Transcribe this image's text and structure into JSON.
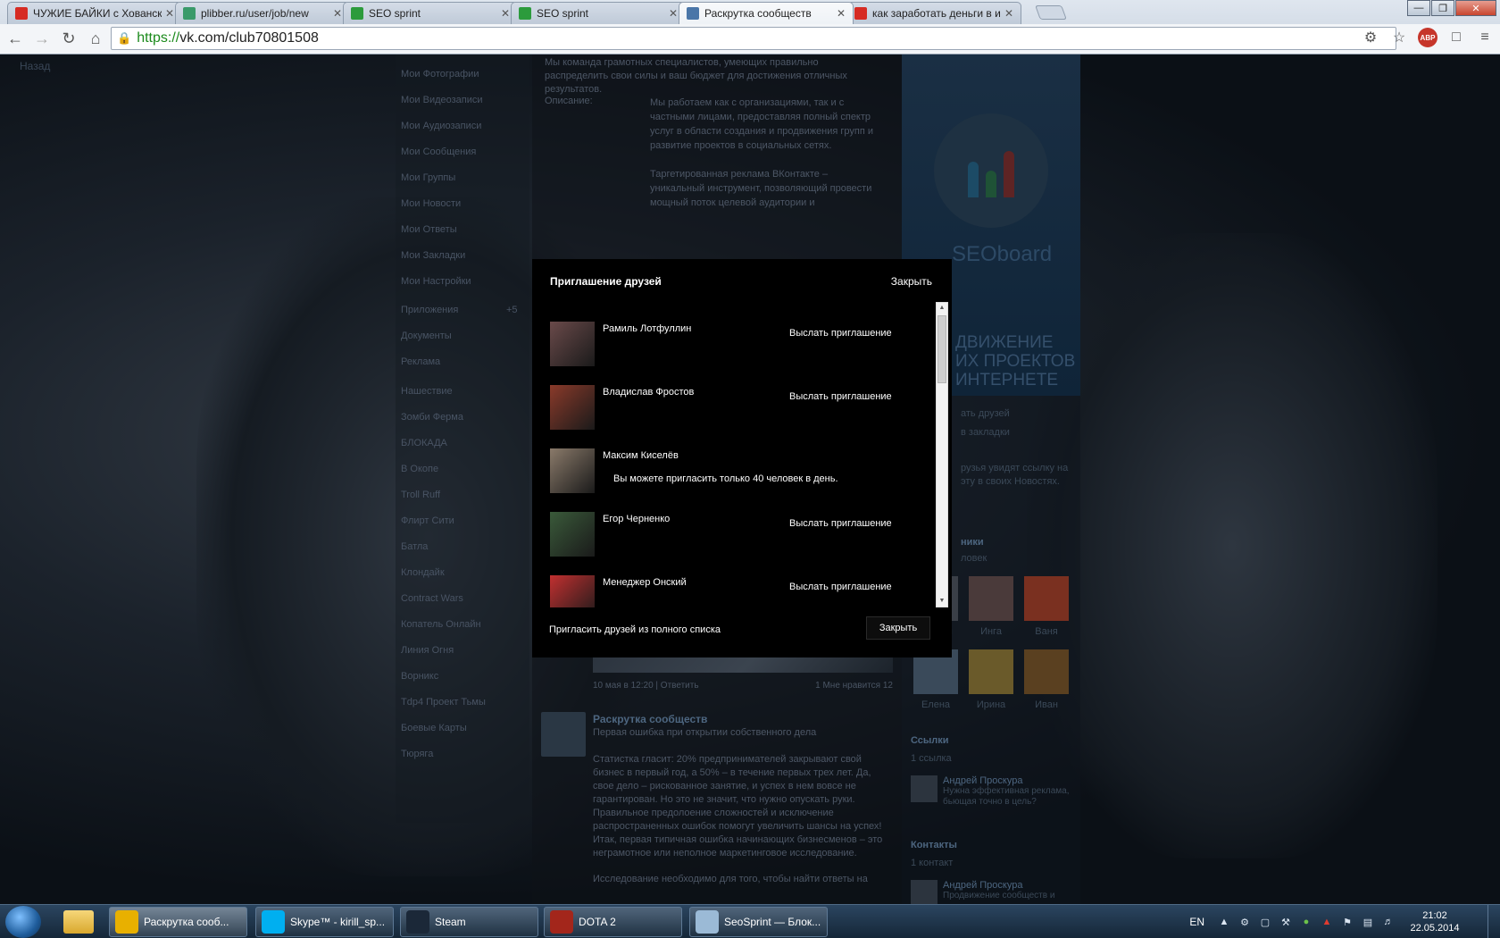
{
  "browser": {
    "tabs": [
      {
        "label": "ЧУЖИЕ БАЙКИ с Хованским",
        "icon": "youtube-icon",
        "color": "#d62b23"
      },
      {
        "label": "plibber.ru/user/job/new",
        "icon": "loading-icon",
        "color": "#3a9a6a"
      },
      {
        "label": "SEO sprint",
        "icon": "seosprint-icon",
        "color": "#2c9b3c"
      },
      {
        "label": "SEO sprint",
        "icon": "seosprint-icon",
        "color": "#2c9b3c"
      },
      {
        "label": "Раскрутка сообществ",
        "icon": "vk-icon",
        "color": "#4a76a8"
      },
      {
        "label": "как заработать деньги в ин",
        "icon": "youtube-icon",
        "color": "#d62b23"
      }
    ],
    "url_scheme": "https://",
    "url_host": "vk.com/club70801508"
  },
  "page": {
    "back_label": "Назад",
    "left_menu": [
      "Мои Фотографии",
      "Мои Видеозаписи",
      "Мои Аудиозаписи",
      "Мои Сообщения",
      "Мои Группы",
      "Мои Новости",
      "Мои Ответы",
      "Мои Закладки",
      "Мои Настройки",
      "Приложения",
      "Документы",
      "Реклама",
      "Нашествие",
      "Зомби Ферма",
      "БЛОКАДА",
      "В Окопе",
      "Troll Ruff",
      "Флирт Сити",
      "Батла",
      "Клондайк",
      "Contract Wars",
      "Копатель Онлайн",
      "Линия Огня",
      "Ворникс",
      "Tdp4 Проект Тьмы",
      "Боевые Карты",
      "Тюряга"
    ],
    "apps_badge": "+5",
    "intro": "Мы команда грамотных специалистов, умеющих правильно распределить свои силы и ваш бюджет для достижения отличных результатов.",
    "desc_label": "Описание:",
    "desc": "Мы работаем как с организациями, так и с частными лицами, предоставляя полный спектр услуг в области создания и продвижения групп и развитие проектов в социальных сетях.",
    "desc2": "Таргетированная реклама ВКонтакте – уникальный инструмент, позволяющий провести мощный поток целевой аудитории и",
    "post_meta_left": "10 мая в 12:20 | Ответить",
    "post_meta_right": "1    Мне нравится    12",
    "post2_title": "Раскрутка сообществ",
    "post2_sub": "Первая ошибка при открытии собственного дела",
    "post2_body": "Статистка гласит: 20% предпринимателей закрывают свой бизнес в первый год, а 50% – в течение первых трех лет. Да, свое дело – рискованное занятие, и успех в нем вовсе не гарантирован. Но это не значит, что нужно опускать руки. Правильное предолоение сложностей и исключение распространенных ошибок помогут увеличить шансы на успех! Итак, первая типичная ошибка начинающих бизнесменов – это неграмотное или неполное маркетинговое исследование.",
    "post2_body_2": "Исследование необходимо для того, чтобы найти ответы на",
    "logo_text": "SEOboard",
    "banner_text": "движение их проектов интернете",
    "rc_links": [
      "ать друзей",
      "в закладки"
    ],
    "rc_note": "рузья увидят ссылку на эту в своих Новостях.",
    "rc_members_head": "ники",
    "rc_members_count": "ловек",
    "friends": [
      "Кирилл",
      "Инга",
      "Ваня",
      "Елена",
      "Ирина",
      "Иван"
    ],
    "links_head": "Ссылки",
    "links_count": "1 ссылка",
    "link_person_name": "Андрей Проскура",
    "link_person_desc": "Нужна эффективная реклама, бьющая точно в цель?",
    "contacts_head": "Контакты",
    "contacts_count": "1 контакт",
    "contact_person_name": "Андрей Проскура",
    "contact_person_desc": "Продвижение сообществ и"
  },
  "modal": {
    "title": "Приглашение друзей",
    "close_top": "Закрыть",
    "invite_label": "Выслать приглашение",
    "limit_message": "Вы можете пригласить только 40 человек в день.",
    "friends": [
      {
        "name": "Рамиль Лотфуллин",
        "invite": true,
        "avatar_color": "#6a4a4a"
      },
      {
        "name": "Владислав Фростов",
        "invite": true,
        "avatar_color": "#8a3a2a"
      },
      {
        "name": "Максим Киселёв",
        "invite": false,
        "avatar_color": "#8a7a6a"
      },
      {
        "name": "Егор Черненко",
        "invite": true,
        "avatar_color": "#3a5a3a"
      },
      {
        "name": "Менеджер Онский",
        "invite": true,
        "avatar_color": "#c23030"
      }
    ],
    "footer_link": "Пригласить друзей из полного списка",
    "close_button": "Закрыть"
  },
  "taskbar": {
    "items": [
      {
        "label": "Раскрутка сооб...",
        "icon": "chrome-icon",
        "color": "#e8b000",
        "active": true
      },
      {
        "label": "Skype™ - kirill_sp...",
        "icon": "skype-icon",
        "color": "#00aff0",
        "active": false
      },
      {
        "label": "Steam",
        "icon": "steam-icon",
        "color": "#1b2838",
        "active": false
      },
      {
        "label": "DOTA 2",
        "icon": "dota-icon",
        "color": "#a3261b",
        "active": false
      },
      {
        "label": "SeoSprint — Блок...",
        "icon": "notepad-icon",
        "color": "#9bbad6",
        "active": false
      }
    ],
    "lang": "EN",
    "time": "21:02",
    "date": "22.05.2014"
  }
}
